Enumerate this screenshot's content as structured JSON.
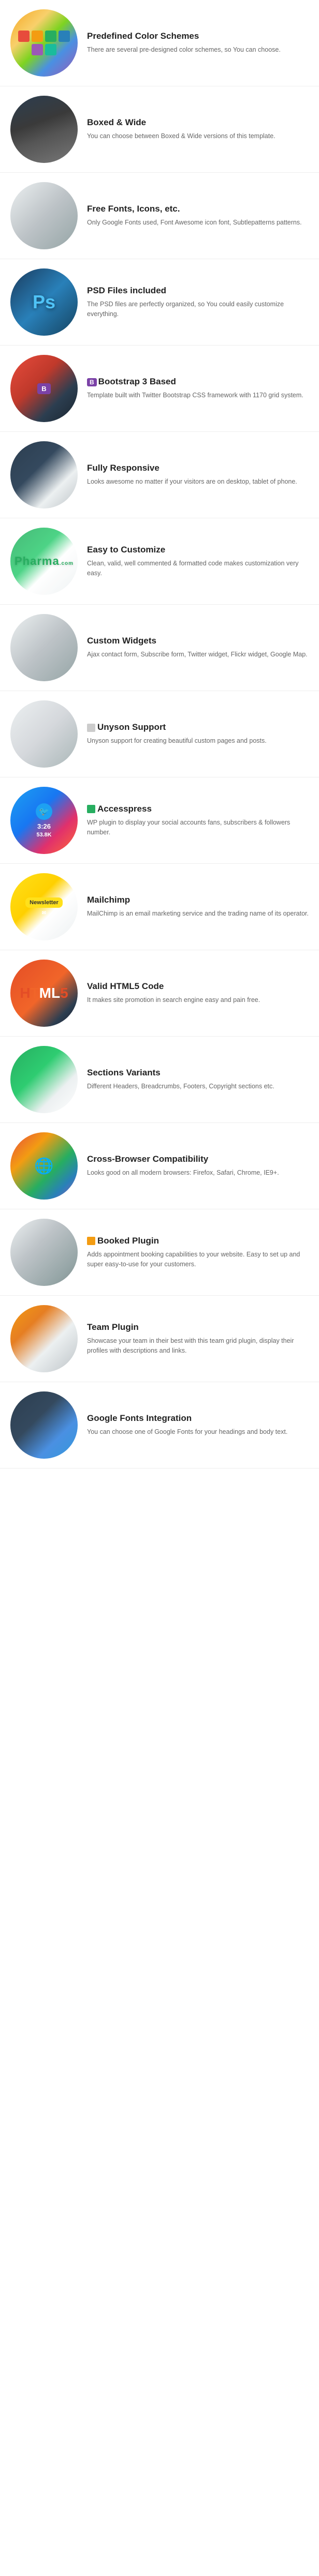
{
  "features": [
    {
      "id": "color-schemes",
      "title": "Predefined Color Schemes",
      "description": "There are several pre-designed color schemes, so You can choose.",
      "image_class": "img-color-schemes"
    },
    {
      "id": "boxed-wide",
      "title": "Boxed & Wide",
      "description": "You can choose between Boxed & Wide versions of this template.",
      "image_class": "img-boxed-wide"
    },
    {
      "id": "free-fonts",
      "title": "Free Fonts, Icons, etc.",
      "description": "Only Google Fonts used, Font Awesome icon font, Subtlepatterns patterns.",
      "image_class": "img-free-fonts"
    },
    {
      "id": "psd-files",
      "title": "PSD Files included",
      "description": "The PSD files are perfectly organized, so You could easily customize everything.",
      "image_class": "img-psd"
    },
    {
      "id": "bootstrap",
      "title": "Bootstrap 3 Based",
      "description": "Template built with Twitter Bootstrap CSS framework with 1170 grid system.",
      "image_class": "img-bootstrap",
      "has_icon": true,
      "icon_color": "#7b42a7"
    },
    {
      "id": "responsive",
      "title": "Fully Responsive",
      "description": "Looks awesome no matter if your visitors are on desktop, tablet of phone.",
      "image_class": "img-responsive"
    },
    {
      "id": "customize",
      "title": "Easy to Customize",
      "description": "Clean, valid, well commented & formatted code makes customization very easy.",
      "image_class": "img-customize",
      "pharma_text": "Pharma"
    },
    {
      "id": "widgets",
      "title": "Custom Widgets",
      "description": "Ajax contact form, Subscribe form, Twitter widget, Flickr widget, Google Map.",
      "image_class": "img-widgets"
    },
    {
      "id": "unyson",
      "title": "Unyson Support",
      "description": "Unyson support for creating beautiful custom pages and posts.",
      "image_class": "img-unyson"
    },
    {
      "id": "accesspress",
      "title": "Accesspress",
      "description": "WP plugin to display your social accounts fans, subscribers & followers number.",
      "image_class": "img-accesspress"
    },
    {
      "id": "mailchimp",
      "title": "Mailchimp",
      "description": "MailChimp is an email marketing service and the trading name of its operator.",
      "image_class": "img-mailchimp"
    },
    {
      "id": "html5",
      "title": "Valid HTML5 Code",
      "description": "It makes site promotion in search engine easy and pain free.",
      "image_class": "img-html5"
    },
    {
      "id": "sections",
      "title": "Sections Variants",
      "description": "Different Headers, Breadcrumbs, Footers, Copyright sections etc.",
      "image_class": "img-sections"
    },
    {
      "id": "crossbrowser",
      "title": "Cross-Browser Compatibility",
      "description": "Looks good on all modern browsers: Firefox, Safari, Chrome, IE9+.",
      "image_class": "img-crossbrowser"
    },
    {
      "id": "booked",
      "title": "Booked Plugin",
      "description": "Adds appointment booking capabilities to your website. Easy to set up and super easy-to-use for your customers.",
      "image_class": "img-booked"
    },
    {
      "id": "team",
      "title": "Team Plugin",
      "description": "Showcase your team in their best with this team grid plugin, display their profiles with descriptions and links.",
      "image_class": "img-team"
    },
    {
      "id": "googlefonts",
      "title": "Google Fonts Integration",
      "description": "You can choose one of Google Fonts for your headings and body text.",
      "image_class": "img-googlefonts"
    }
  ],
  "colors": {
    "swatches": [
      "#e74c3c",
      "#f39c12",
      "#27ae60",
      "#2980b9",
      "#9b59b6",
      "#1abc9c"
    ]
  }
}
